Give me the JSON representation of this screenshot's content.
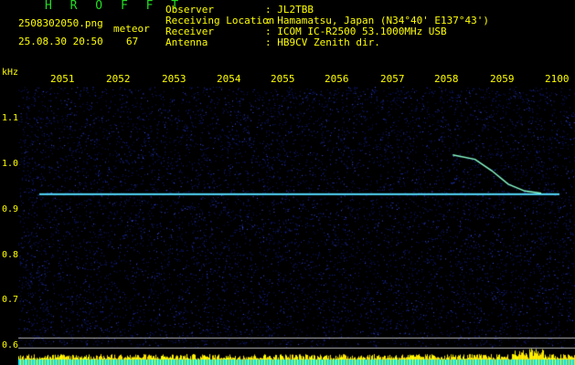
{
  "header": {
    "title": "H R O F F T",
    "filename": "2508302050.png",
    "datetime": "25.08.30 20:50",
    "meteor_label": "meteor",
    "meteor_count": "67",
    "fields": [
      {
        "label": "Observer",
        "value": ": JL2TBB"
      },
      {
        "label": "Receiving Location",
        "value": ": Hamamatsu, Japan (N34°40' E137°43')"
      },
      {
        "label": "Receiver",
        "value": ": ICOM IC-R2500 53.1000MHz USB"
      },
      {
        "label": "Antenna",
        "value": ": HB9CV Zenith dir."
      }
    ]
  },
  "axes": {
    "y_unit": "kHz",
    "x_ticks": [
      "2051",
      "2052",
      "2053",
      "2054",
      "2055",
      "2056",
      "2057",
      "2058",
      "2059",
      "2100"
    ],
    "y_ticks": [
      "1.1",
      "1.0",
      "0.9",
      "0.8",
      "0.7",
      "0.6"
    ]
  },
  "colors": {
    "text": "#ffff00",
    "title": "#22dd22",
    "background": "#000000",
    "noise": "#1a2aa8",
    "carrier": "#55ddff",
    "trace": "#88ffcc"
  },
  "signals": {
    "carrier_khz": 0.935,
    "meteor_trace": [
      [
        2058.2,
        1.02
      ],
      [
        2058.6,
        1.01
      ],
      [
        2058.9,
        0.985
      ],
      [
        2059.2,
        0.955
      ],
      [
        2059.5,
        0.94
      ],
      [
        2059.8,
        0.935
      ]
    ]
  }
}
